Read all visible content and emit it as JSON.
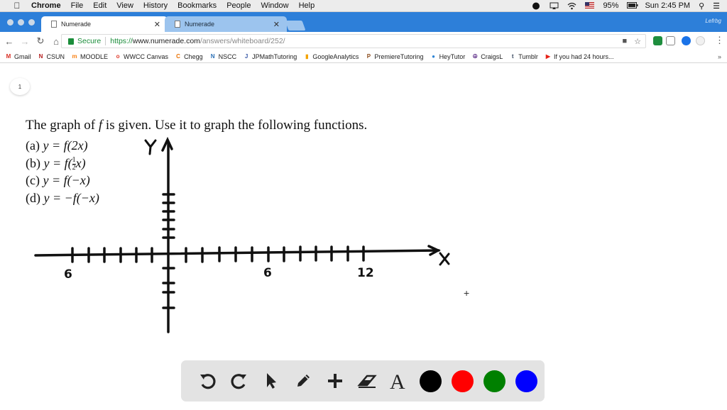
{
  "menubar": {
    "app": "Chrome",
    "items": [
      "File",
      "Edit",
      "View",
      "History",
      "Bookmarks",
      "People",
      "Window",
      "Help"
    ],
    "battery": "95%",
    "clock": "Sun 2:45 PM"
  },
  "tabs": [
    {
      "label": "Numerade",
      "active": true
    },
    {
      "label": "Numerade",
      "active": false
    }
  ],
  "profile_label": "Lefrbg",
  "omnibox": {
    "secure_label": "Secure",
    "url_proto": "https://",
    "url_host": "www.numerade.com",
    "url_path": "/answers/whiteboard/252/"
  },
  "bookmarks": [
    {
      "label": "Gmail",
      "icon": "gmail-icon",
      "color": "#d93025",
      "glyph": "M"
    },
    {
      "label": "CSUN",
      "icon": "csun-icon",
      "color": "#b31b1b",
      "glyph": "N"
    },
    {
      "label": "MOODLE",
      "icon": "moodle-icon",
      "color": "#f98012",
      "glyph": "m"
    },
    {
      "label": "WWCC Canvas",
      "icon": "canvas-icon",
      "color": "#e13b2b",
      "glyph": "o"
    },
    {
      "label": "Chegg",
      "icon": "chegg-icon",
      "color": "#eb7100",
      "glyph": "C"
    },
    {
      "label": "NSCC",
      "icon": "nscc-icon",
      "color": "#2a6fb5",
      "glyph": "N"
    },
    {
      "label": "JPMathTutoring",
      "icon": "jpmath-icon",
      "color": "#3b5aa8",
      "glyph": "J"
    },
    {
      "label": "GoogleAnalytics",
      "icon": "analytics-icon",
      "color": "#f4a300",
      "glyph": "▮"
    },
    {
      "label": "PremiereTutoring",
      "icon": "premiere-icon",
      "color": "#8a4a1a",
      "glyph": "P"
    },
    {
      "label": "HeyTutor",
      "icon": "heytutor-icon",
      "color": "#2d84d5",
      "glyph": "●"
    },
    {
      "label": "CraigsL",
      "icon": "peace-icon",
      "color": "#5b2a86",
      "glyph": "☮"
    },
    {
      "label": "Tumblr",
      "icon": "tumblr-icon",
      "color": "#36465d",
      "glyph": "t"
    },
    {
      "label": "If you had 24 hours...",
      "icon": "youtube-icon",
      "color": "#e62117",
      "glyph": "▶"
    }
  ],
  "board": {
    "page_number": "1",
    "problem_intro_a": "The graph of ",
    "problem_intro_f": "f",
    "problem_intro_b": " is given. Use it to graph the following functions.",
    "parts": [
      {
        "tag": "(a)",
        "expr": "y = f(2x)"
      },
      {
        "tag": "(b)",
        "expr_pre": "y = f(",
        "frac_num": "1",
        "frac_den": "2",
        "expr_post": "x)"
      },
      {
        "tag": "(c)",
        "expr": "y = f(−x)"
      },
      {
        "tag": "(d)",
        "expr": "y = −f(−x)"
      }
    ],
    "graph_labels": {
      "y_axis": "y",
      "x_axis": "x",
      "tick_neg": "6",
      "tick_pos6": "6",
      "tick_pos12": "12"
    }
  },
  "drawbar": {
    "tools": [
      "undo-icon",
      "redo-icon",
      "pointer-icon",
      "pen-icon",
      "add-icon",
      "eraser-icon",
      "text-icon"
    ],
    "colors": [
      "#000000",
      "#ff0000",
      "#008000",
      "#0000ff"
    ]
  }
}
